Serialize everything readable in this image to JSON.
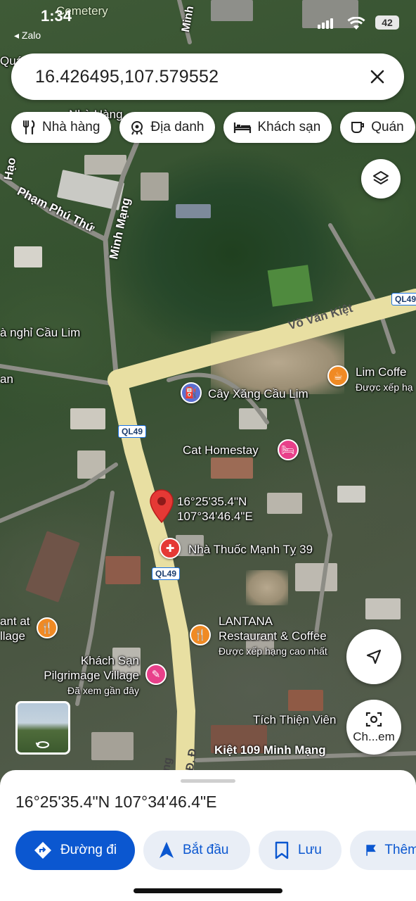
{
  "status_bar": {
    "time": "1:34",
    "back_label": "◂ Zalo",
    "battery": "42",
    "map_fragment": "Cemetery"
  },
  "search": {
    "query": "16.426495,107.579552"
  },
  "chips": [
    {
      "icon": "fork-knife-icon",
      "label": "Nhà hàng"
    },
    {
      "icon": "landmark-icon",
      "label": "Địa danh"
    },
    {
      "icon": "bed-icon",
      "label": "Khách sạn"
    },
    {
      "icon": "coffee-cup-icon",
      "label": "Quán"
    }
  ],
  "map": {
    "roads": {
      "vo_van_kiet": "Võ Văn Kiệt",
      "minh_mang_top": "Minh",
      "minh_mang": "Minh Mạng",
      "pham_phu_thu": "Phạm Phú Thứ",
      "hao": "Hạo",
      "kiet_109": "Kiệt 109 Minh Mạng",
      "bottom_road": "Đ. Đ",
      "bottom_road2": "ng"
    },
    "route_badges": [
      "QL49",
      "QL49",
      "QL49"
    ],
    "pois": {
      "nha_nghi": "à nghỉ Cầu Lim",
      "an": "an",
      "lim_coffee": "Lim Coffe",
      "lim_coffee_sub": "Được xếp hạ",
      "gas_station": "Cây Xăng Cầu Lim",
      "cat_homestay": "Cat Homestay",
      "pharmacy": "Nhà Thuốc Mạnh Tỵ 39",
      "restaurant_at": "ant at",
      "village": "llage",
      "lantana_1": "LANTANA",
      "lantana_2": "Restaurant & Coffee",
      "lantana_sub": "Được xếp hạng cao nhất",
      "khach_san_1": "Khách Sạn",
      "khach_san_2": "Pilgrimage Village",
      "khach_san_sub": "Đã xem gần đây",
      "tich_thien": "Tích Thiện Viên",
      "nha_hang_top": "Nhà Hàng",
      "quan_left": "Quá"
    },
    "pin_label_lat": "16°25'35.4\"N",
    "pin_label_lng": "107°34'46.4\"E"
  },
  "buttons": {
    "streetview_label": "Ch...em"
  },
  "sheet": {
    "coords": "16°25'35.4\"N 107°34'46.4\"E",
    "actions": [
      {
        "icon": "directions-icon",
        "label": "Đường đi"
      },
      {
        "icon": "navigation-arrow-icon",
        "label": "Bắt đầu"
      },
      {
        "icon": "bookmark-icon",
        "label": "Lưu"
      },
      {
        "icon": "flag-icon",
        "label": "Thêm"
      }
    ]
  },
  "colors": {
    "primary": "#0b57d0",
    "pin_red": "#e53935",
    "poi_orange": "#f08a24",
    "poi_pink": "#e8408a",
    "poi_blue": "#5b6fd1",
    "road_yellow": "#e8dfa2"
  }
}
